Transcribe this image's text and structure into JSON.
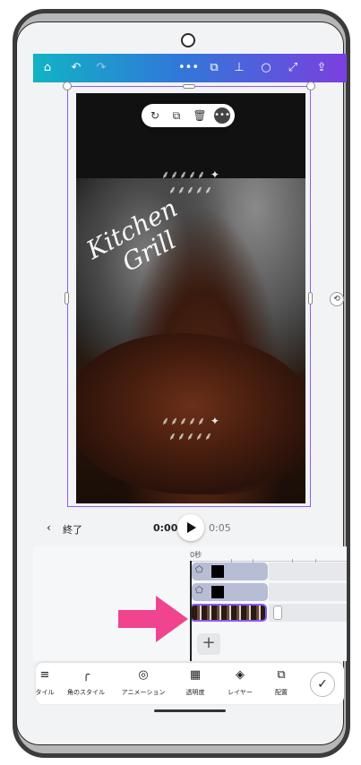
{
  "toolbar_top": {
    "icons": [
      "home-icon",
      "undo-icon",
      "redo-icon",
      "more-icon",
      "duplicate-page-icon",
      "chart-icon",
      "comment-icon",
      "expand-icon",
      "share-icon"
    ]
  },
  "canvas": {
    "script_line1": "Kitchen",
    "script_line2": "Grill",
    "laurel_top": "⸙⸙⸙⸙⸙ ✦ ⸙⸙⸙⸙⸙",
    "laurel_bottom": "⸙⸙⸙⸙⸙ ✦ ⸙⸙⸙⸙⸙"
  },
  "context_menu": {
    "icons": [
      "add-comment-icon",
      "copy-icon",
      "trash-icon",
      "more-icon"
    ],
    "more_label": "•••"
  },
  "playback": {
    "back_label": "終了",
    "current_time": "0:00",
    "total_time": "0:05"
  },
  "timeline": {
    "ruler_label": "0秒"
  },
  "bottom_toolbar": {
    "items": [
      {
        "label": "タイル",
        "icon": "style-icon"
      },
      {
        "label": "角のスタイル",
        "icon": "corner-style-icon"
      },
      {
        "label": "アニメーション",
        "icon": "animation-icon"
      },
      {
        "label": "透明度",
        "icon": "transparency-icon"
      },
      {
        "label": "レイヤー",
        "icon": "layers-icon"
      },
      {
        "label": "配置",
        "icon": "position-icon"
      }
    ]
  },
  "colors": {
    "accent": "#8b5cf6",
    "arrow": "#f0458e",
    "gradient_start": "#11b3c5",
    "gradient_end": "#7a3fe0"
  }
}
